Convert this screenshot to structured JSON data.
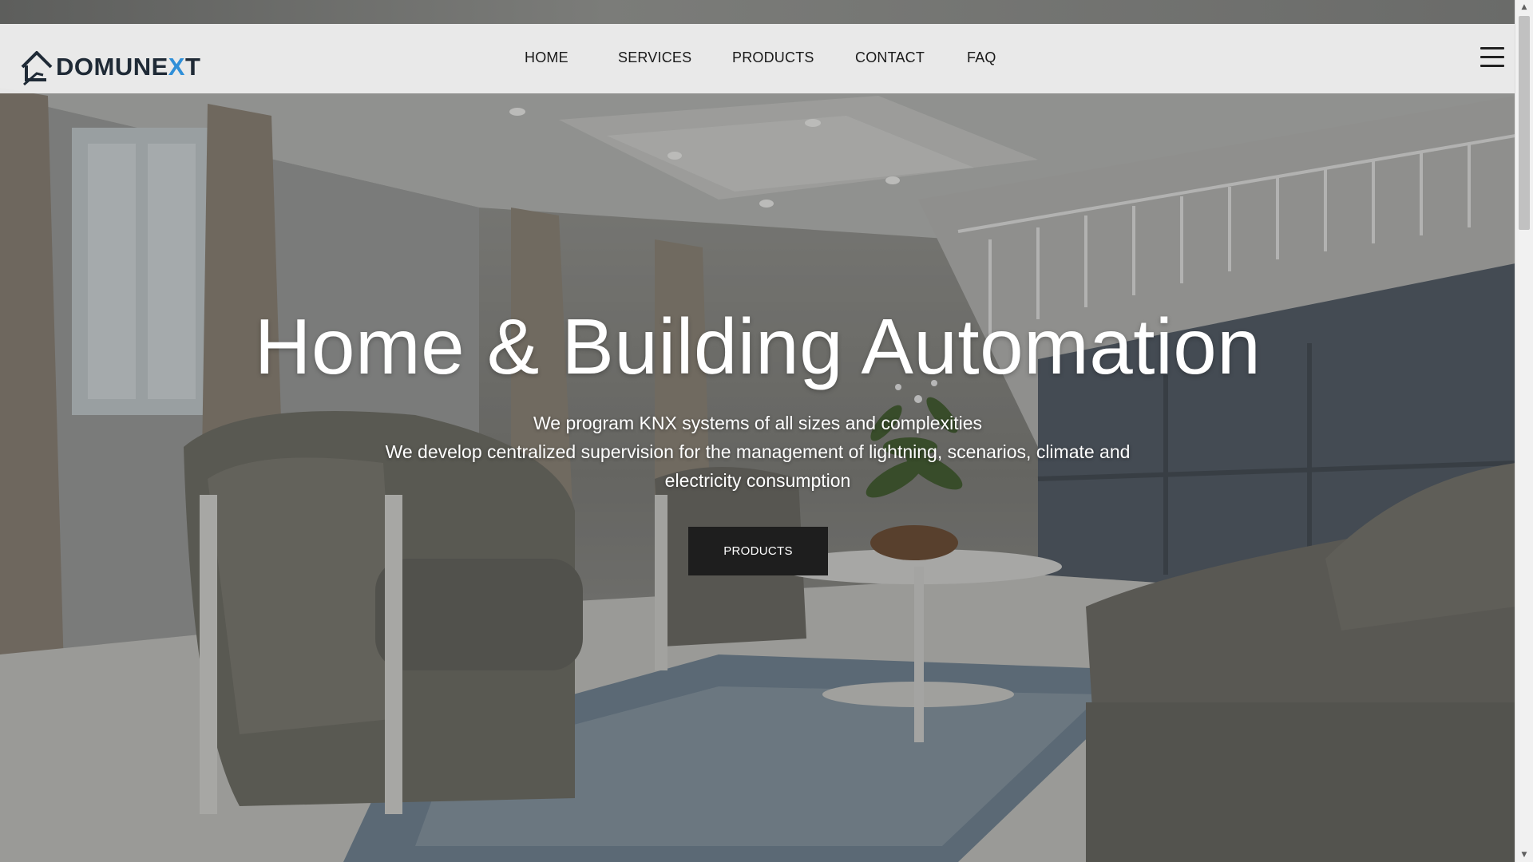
{
  "logo": {
    "text_main": "DOMUNE",
    "text_accent": "X",
    "text_end": "T"
  },
  "nav": {
    "items": [
      {
        "label": "HOME"
      },
      {
        "label": "SERVICES"
      },
      {
        "label": "PRODUCTS"
      },
      {
        "label": "CONTACT"
      },
      {
        "label": "FAQ"
      }
    ],
    "menu_icon": "hamburger-menu-icon"
  },
  "hero": {
    "title": "Home & Building Automation",
    "subtitle_line1": "We program KNX systems of all sizes and complexities",
    "subtitle_line2": "We develop centralized supervision for the management of lightning, scenarios, climate and electricity consumption",
    "cta_label": "PRODUCTS"
  },
  "colors": {
    "navbar_bg": "#ececec",
    "cta_bg": "#1e1e1e",
    "logo_accent": "#2f8fd8",
    "text_light": "#ffffff"
  },
  "icons": {
    "logo": "house-logo-icon",
    "scroll_up": "triangle-up-icon",
    "scroll_down": "triangle-down-icon"
  }
}
